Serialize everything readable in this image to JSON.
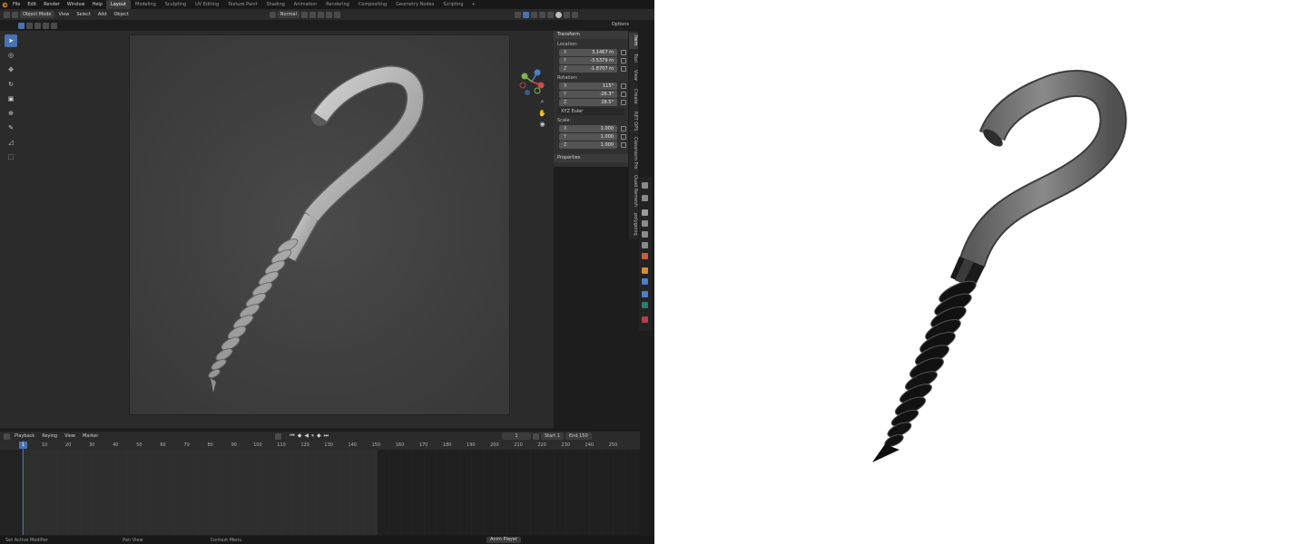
{
  "app": {
    "menus": [
      "File",
      "Edit",
      "Render",
      "Window",
      "Help"
    ],
    "workspaces": [
      "Layout",
      "Modeling",
      "Sculpting",
      "UV Editing",
      "Texture Paint",
      "Shading",
      "Animation",
      "Rendering",
      "Compositing",
      "Geometry Nodes",
      "Scripting"
    ],
    "active_workspace": "Layout",
    "add_workspace": "+"
  },
  "header": {
    "mode": "Object Mode",
    "menu": [
      "View",
      "Select",
      "Add",
      "Object"
    ],
    "orientation": "Normal",
    "options": "Options"
  },
  "transform_panel": {
    "title": "Transform",
    "location_label": "Location:",
    "location": [
      {
        "axis": "X",
        "value": "3.1467 m"
      },
      {
        "axis": "Y",
        "value": "-3.5379 m"
      },
      {
        "axis": "Z",
        "value": "-1.8707 m"
      }
    ],
    "rotation_label": "Rotation:",
    "rotation": [
      {
        "axis": "X",
        "value": "115°"
      },
      {
        "axis": "Y",
        "value": "-26.3°"
      },
      {
        "axis": "Z",
        "value": "28.5°"
      }
    ],
    "rotation_mode": "XYZ Euler",
    "scale_label": "Scale:",
    "scale": [
      {
        "axis": "X",
        "value": "1.000"
      },
      {
        "axis": "Y",
        "value": "1.000"
      },
      {
        "axis": "Z",
        "value": "1.000"
      }
    ],
    "properties": "Properties"
  },
  "sidebar_tabs": [
    "Item",
    "Tool",
    "View",
    "Create",
    "RET OPS",
    "Classroom Pro",
    "Quad Remesh",
    "polygoniq"
  ],
  "timeline": {
    "menus": [
      "Playback",
      "Keying",
      "View",
      "Marker"
    ],
    "current_frame": "1",
    "start_label": "Start",
    "start": "1",
    "end_label": "End",
    "end": "150",
    "ticks": [
      "1",
      "10",
      "20",
      "30",
      "40",
      "50",
      "60",
      "70",
      "80",
      "90",
      "100",
      "110",
      "120",
      "130",
      "140",
      "150",
      "160",
      "170",
      "180",
      "190",
      "200",
      "210",
      "220",
      "230",
      "240",
      "250"
    ]
  },
  "status": {
    "set_active_modifier": "Set Active Modifier",
    "pan_view": "Pan View",
    "context_menu": "Context Menu",
    "anim_player": "Anim Player"
  },
  "colors": {
    "accent": "#4772b3",
    "model_clay": "#b8b8b8",
    "product_gray": "#6e6e6e",
    "product_black": "#141414"
  }
}
